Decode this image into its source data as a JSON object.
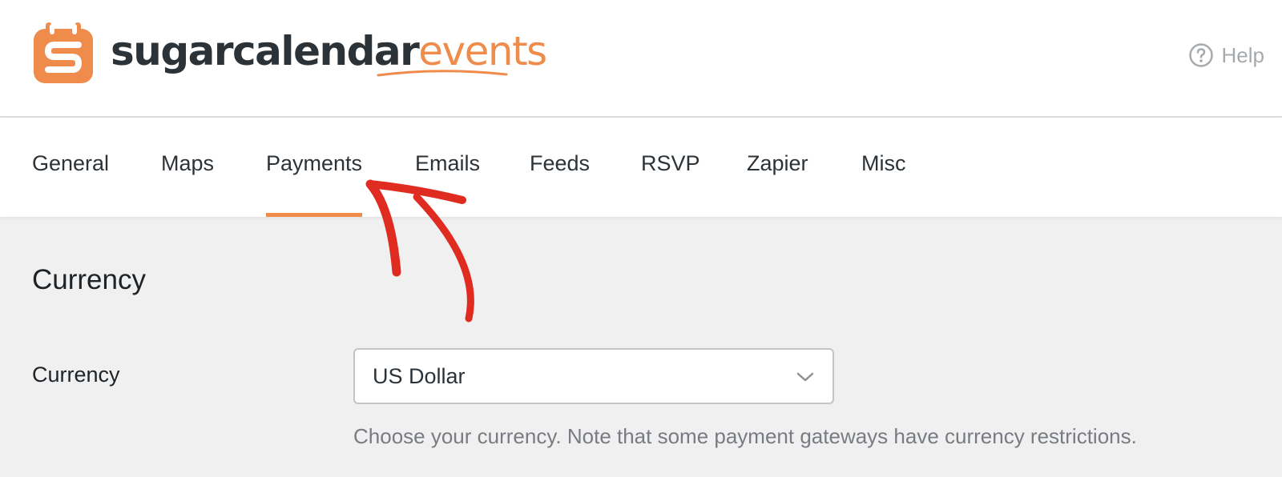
{
  "header": {
    "logo": {
      "brand_part1": "sugarcalendar",
      "brand_part2": "events",
      "icon": "calendar-s-logo-icon"
    },
    "help_label": "Help",
    "help_icon": "question-circle-icon"
  },
  "tabs": [
    {
      "label": "General",
      "active": false
    },
    {
      "label": "Maps",
      "active": false
    },
    {
      "label": "Payments",
      "active": true
    },
    {
      "label": "Emails",
      "active": false
    },
    {
      "label": "Feeds",
      "active": false
    },
    {
      "label": "RSVP",
      "active": false
    },
    {
      "label": "Zapier",
      "active": false
    },
    {
      "label": "Misc",
      "active": false
    }
  ],
  "section": {
    "title": "Currency",
    "fields": [
      {
        "label": "Currency",
        "selected_value": "US Dollar",
        "help_text": "Choose your currency. Note that some payment gateways have currency restrictions."
      }
    ]
  },
  "annotation": {
    "type": "hand-drawn-arrow",
    "points_to": "Payments tab",
    "color": "#e02b20"
  },
  "colors": {
    "accent": "#ef8c4c",
    "text_dark": "#2c3338",
    "text_muted": "#787c82",
    "background": "#f0f0f1"
  }
}
